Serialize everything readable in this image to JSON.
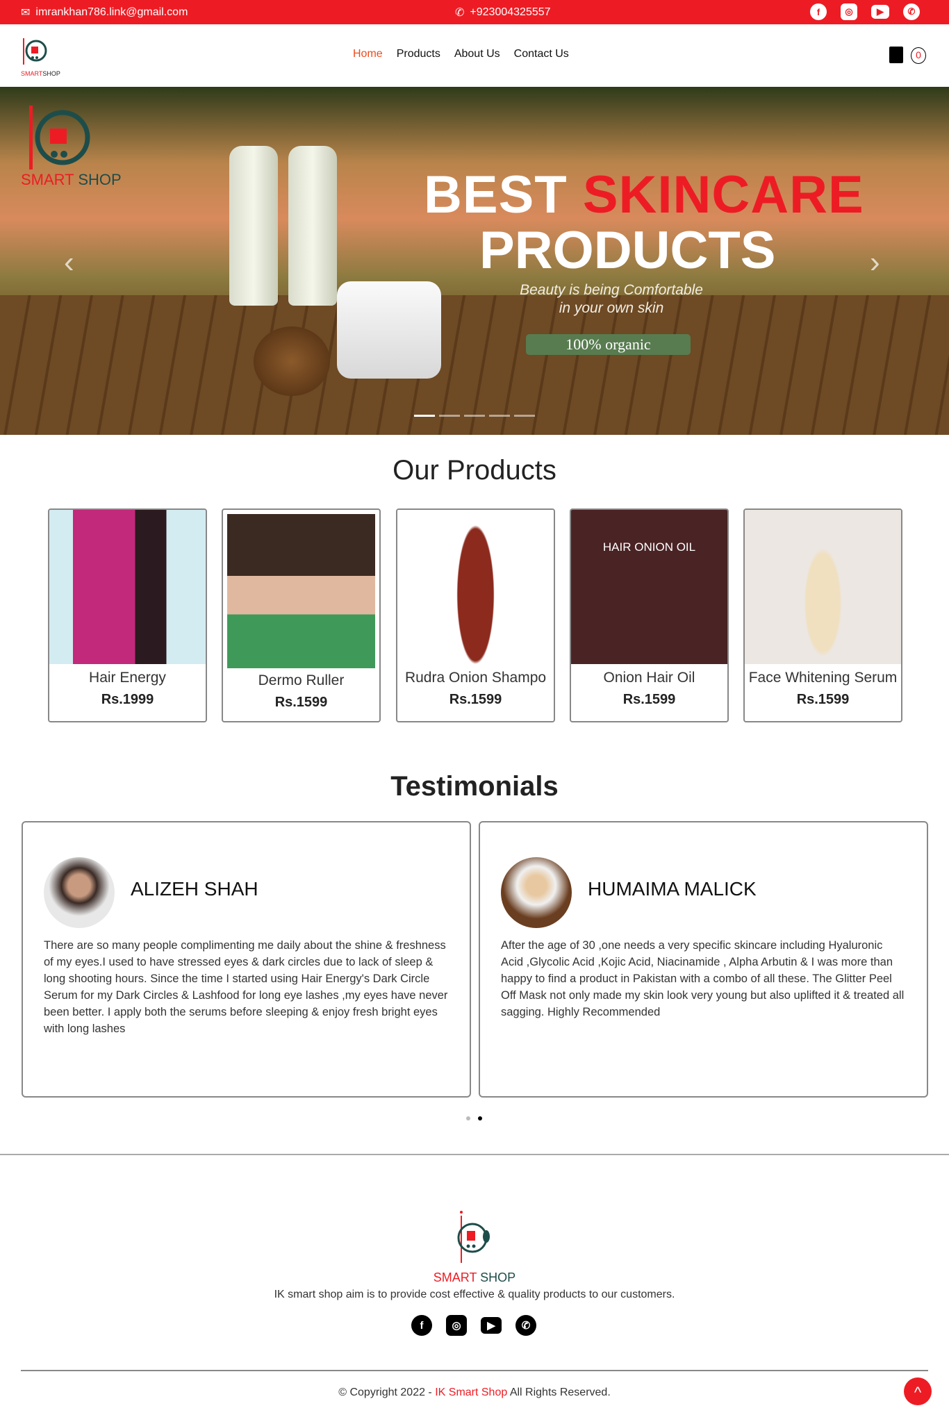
{
  "topbar": {
    "email": "imrankhan786.link@gmail.com",
    "phone": "+923004325557",
    "social": [
      "facebook-icon",
      "instagram-icon",
      "youtube-icon",
      "whatsapp-icon"
    ]
  },
  "nav": {
    "logo_text_red": "SMART",
    "logo_text_dark": "SHOP",
    "items": [
      {
        "label": "Home",
        "active": true
      },
      {
        "label": "Products"
      },
      {
        "label": "About Us"
      },
      {
        "label": "Contact Us"
      }
    ],
    "cart_count": "0"
  },
  "hero": {
    "line1_white": "BEST",
    "line1_red": "SKINCARE",
    "line2": "PRODUCTS",
    "tagline1": "Beauty is being Comfortable",
    "tagline2": "in your own skin",
    "badge": "100% organic",
    "slides": 5,
    "active_slide": 1,
    "prev": "‹",
    "next": "›"
  },
  "products": {
    "title": "Our Products",
    "items": [
      {
        "name": "Hair Energy",
        "price": "Rs.1999"
      },
      {
        "name": "Dermo Ruller",
        "price": "Rs.1599"
      },
      {
        "name": "Rudra Onion Shampo",
        "price": "Rs.1599"
      },
      {
        "name": "Onion Hair Oil",
        "price": "Rs.1599"
      },
      {
        "name": "Face Whitening Serum",
        "price": "Rs.1599"
      }
    ]
  },
  "testimonials": {
    "title": "Testimonials",
    "items": [
      {
        "name": "ALIZEH SHAH",
        "text": "There are so many people complimenting me daily about the shine & freshness of my eyes.I used to have stressed eyes & dark circles due to lack of sleep & long shooting hours. Since the time I started using Hair Energy's Dark Circle Serum for my Dark Circles & Lashfood for long eye lashes ,my eyes have never been better. I apply both the serums before sleeping & enjoy fresh bright eyes with long lashes"
      },
      {
        "name": "HUMAIMA MALICK",
        "text": "After the age of 30 ,one needs a very specific skincare including Hyaluronic Acid ,Glycolic Acid ,Kojic Acid, Niacinamide , Alpha Arbutin & I was more than happy to find a product in Pakistan with a combo of all these. The Glitter Peel Off Mask not only made my skin look very young but also uplifted it & treated all sagging. Highly Recommended"
      }
    ]
  },
  "footer": {
    "logo_text_red": "SMART",
    "logo_text_dark": "SHOP",
    "about": "IK smart shop aim is to provide cost effective & quality products to our customers.",
    "copyright_prefix": "© Copyright 2022 - ",
    "brand": "IK Smart Shop",
    "copyright_suffix": " All Rights Reserved."
  },
  "colors": {
    "brand_red": "#ed1c24",
    "organic_green": "#587c50"
  }
}
